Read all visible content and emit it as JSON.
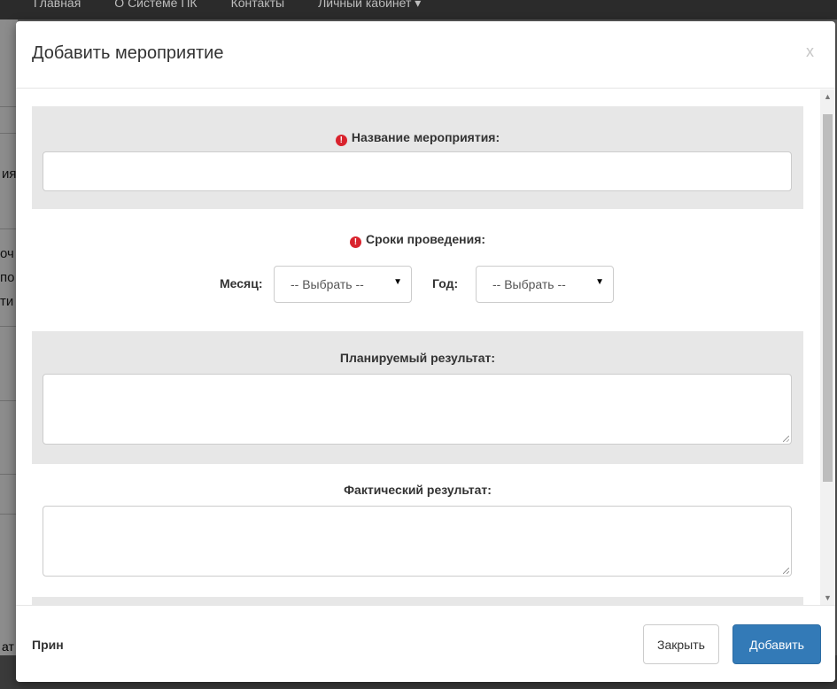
{
  "background": {
    "nav_items": [
      "Главная",
      "О Системе ПК",
      "Контакты",
      "Личный кабинет ▾"
    ],
    "fragments": [
      "ия",
      "оч",
      "по",
      "ти"
    ],
    "bottom_fragment": "ат"
  },
  "modal": {
    "title": "Добавить мероприятие",
    "close_label": "x",
    "event_name": {
      "label": "Название мероприятия:",
      "value": "",
      "required_icon": "exclamation-circle-icon"
    },
    "dates": {
      "label": "Сроки проведения:",
      "required_icon": "exclamation-circle-icon",
      "month_label": "Месяц:",
      "month_value": "-- Выбрать --",
      "year_label": "Год:",
      "year_value": "-- Выбрать --"
    },
    "planned_result": {
      "label": "Планируемый результат:",
      "value": ""
    },
    "actual_result": {
      "label": "Фактический результат:",
      "value": ""
    },
    "footer": {
      "note": "Прин",
      "close_button": "Закрыть",
      "add_button": "Добавить"
    }
  },
  "colors": {
    "primary": "#337ab7",
    "required": "#d9232d",
    "section_gray": "#e7e7e7"
  }
}
